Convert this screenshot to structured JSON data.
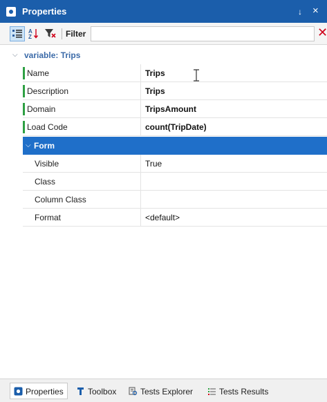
{
  "panel": {
    "title": "Properties",
    "pin_glyph": "↓",
    "close_glyph": "×"
  },
  "toolbar": {
    "filter_label": "Filter",
    "filter_value": "",
    "filter_placeholder": "",
    "clear_glyph": "✕"
  },
  "category": {
    "label": "variable: Trips",
    "expanded": true
  },
  "properties": [
    {
      "name": "Name",
      "value": "Trips"
    },
    {
      "name": "Description",
      "value": "Trips"
    },
    {
      "name": "Domain",
      "value": "TripsAmount"
    },
    {
      "name": "Load Code",
      "value": "count(TripDate)"
    }
  ],
  "form_group": {
    "label": "Form",
    "expanded": true,
    "properties": [
      {
        "name": "Visible",
        "value": "True"
      },
      {
        "name": "Class",
        "value": ""
      },
      {
        "name": "Column Class",
        "value": ""
      },
      {
        "name": "Format",
        "value": "<default>"
      }
    ]
  },
  "bottom_tabs": [
    {
      "label": "Properties",
      "active": true,
      "icon": "properties-icon"
    },
    {
      "label": "Toolbox",
      "active": false,
      "icon": "toolbox-icon"
    },
    {
      "label": "Tests Explorer",
      "active": false,
      "icon": "tests-explorer-icon"
    },
    {
      "label": "Tests Results",
      "active": false,
      "icon": "tests-results-icon"
    }
  ],
  "colors": {
    "title_bar": "#1b5eab",
    "selection": "#1f6fc9",
    "modified_marker": "#2ea043",
    "category_text": "#3b6aa8",
    "clear_button": "#d0021b"
  }
}
